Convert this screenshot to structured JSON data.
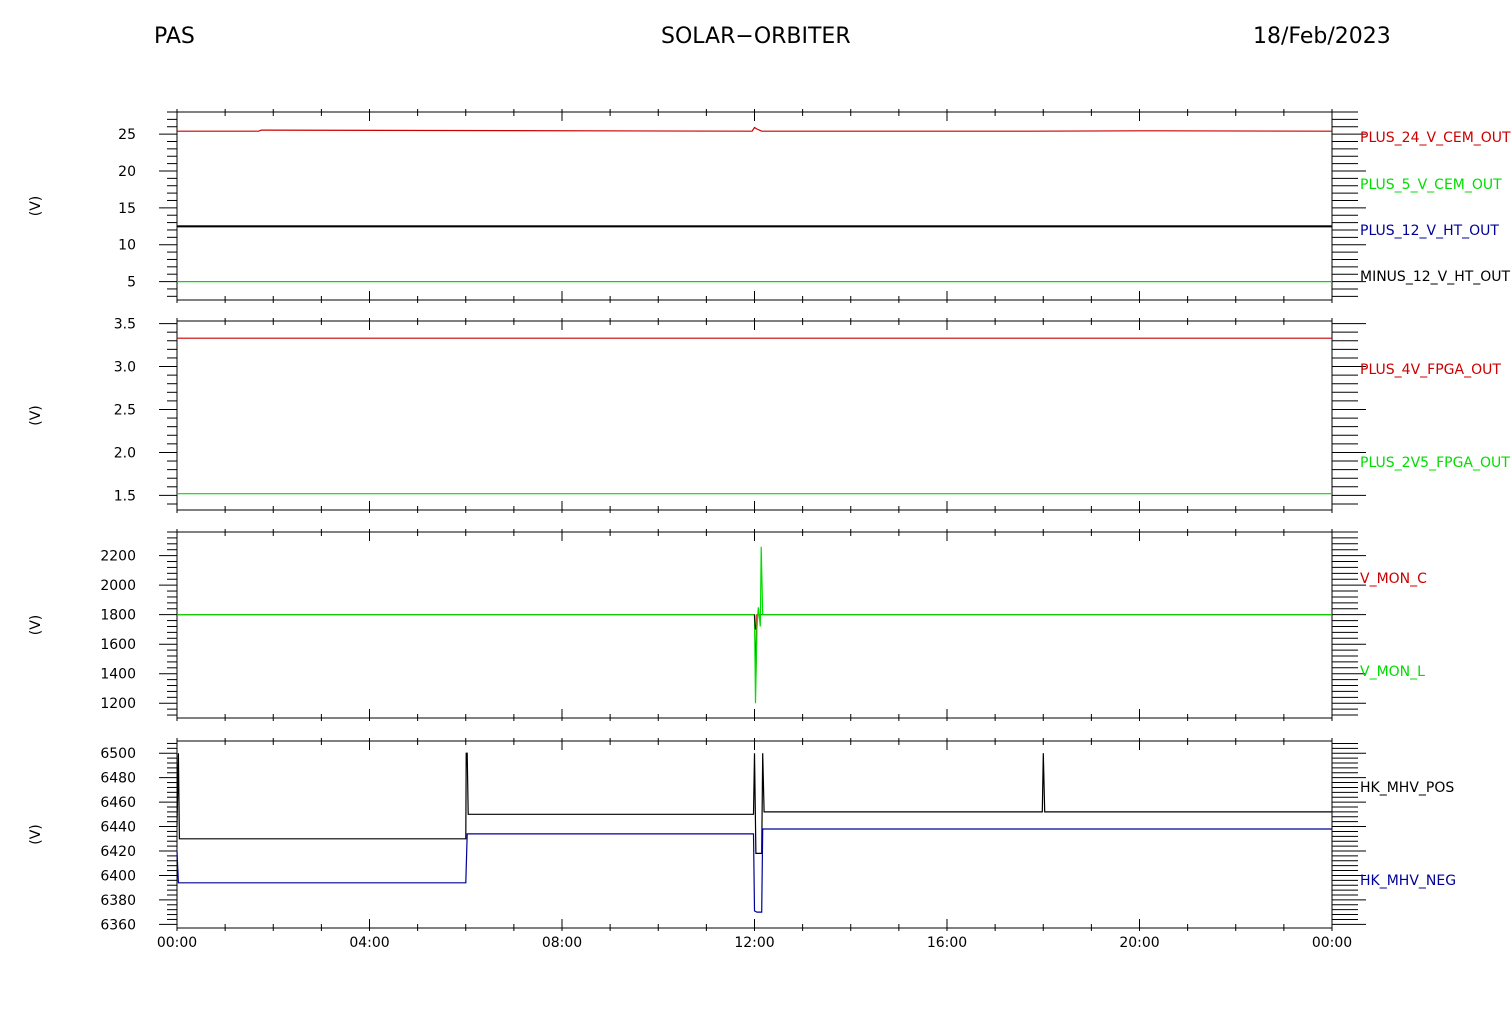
{
  "header": {
    "left": "PAS",
    "center": "SOLAR−ORBITER",
    "right": "18/Feb/2023"
  },
  "chart_data": [
    {
      "type": "line",
      "ylabel": "(V)",
      "ylim": [
        2.5,
        28
      ],
      "yticks": [
        5,
        10,
        15,
        20,
        25
      ],
      "ytick_labels": [
        "5",
        "10",
        "15",
        "20",
        "25"
      ],
      "series": [
        {
          "name": "PLUS_24_V_CEM_OUT",
          "color": "#cc0000",
          "x": [
            0,
            1.7,
            1.75,
            11.95,
            12.0,
            12.05,
            12.15,
            17.7,
            20.3,
            24
          ],
          "y": [
            25.4,
            25.4,
            25.55,
            25.4,
            25.9,
            25.7,
            25.4,
            25.4,
            25.45,
            25.4
          ]
        },
        {
          "name": "PLUS_5_V_CEM_OUT",
          "color": "#00dd00",
          "x": [
            0,
            24
          ],
          "y": [
            5.0,
            5.0
          ]
        },
        {
          "name": "PLUS_12_V_HT_OUT",
          "color": "#000099",
          "x": [
            0,
            24
          ],
          "y": [
            12.5,
            12.5
          ]
        },
        {
          "name": "MINUS_12_V_HT_OUT",
          "color": "#000000",
          "x": [
            0,
            24
          ],
          "y": [
            12.45,
            12.45
          ]
        }
      ]
    },
    {
      "type": "line",
      "ylabel": "(V)",
      "ylim": [
        1.33,
        3.53
      ],
      "yticks": [
        1.5,
        2.0,
        2.5,
        3.0,
        3.5
      ],
      "ytick_labels": [
        "1.5",
        "2.0",
        "2.5",
        "3.0",
        "3.5"
      ],
      "series": [
        {
          "name": "PLUS_4V_FPGA_OUT",
          "color": "#cc0000",
          "x": [
            0,
            24
          ],
          "y": [
            3.33,
            3.33
          ]
        },
        {
          "name": "PLUS_2V5_FPGA_OUT",
          "color": "#00dd00",
          "x": [
            0,
            24
          ],
          "y": [
            1.52,
            1.52
          ]
        }
      ]
    },
    {
      "type": "line",
      "ylabel": "(V)",
      "ylim": [
        1100,
        2360
      ],
      "yticks": [
        1200,
        1400,
        1600,
        1800,
        2000,
        2200
      ],
      "ytick_labels": [
        "1200",
        "1400",
        "1600",
        "1800",
        "2000",
        "2200"
      ],
      "series": [
        {
          "name": "V_MON_C",
          "color": "#cc0000",
          "x": [
            0,
            11.98,
            12.0,
            12.03,
            12.05,
            24
          ],
          "y": [
            1800,
            1800,
            1800,
            1380,
            1800,
            1800
          ]
        },
        {
          "name": "V_MON_L",
          "color": "#00dd00",
          "x": [
            0,
            11.98,
            12.0,
            12.02,
            12.05,
            12.08,
            12.12,
            12.14,
            12.17,
            12.2,
            24
          ],
          "y": [
            1800,
            1800,
            1800,
            1200,
            1700,
            1850,
            1720,
            2260,
            1800,
            1800,
            1800
          ]
        },
        {
          "name": "",
          "color": "#000000",
          "x": [
            12.0,
            12.02
          ],
          "y": [
            1800,
            1700
          ]
        }
      ]
    },
    {
      "type": "line",
      "ylabel": "(V)",
      "ylim": [
        6357,
        6510
      ],
      "yticks": [
        6360,
        6380,
        6400,
        6420,
        6440,
        6460,
        6480,
        6500
      ],
      "ytick_labels": [
        "6360",
        "6380",
        "6400",
        "6420",
        "6440",
        "6460",
        "6480",
        "6500"
      ],
      "series": [
        {
          "name": "HK_MHV_POS",
          "color": "#000000",
          "x": [
            0,
            0.03,
            0.05,
            0.08,
            6.0,
            6.01,
            6.03,
            6.05,
            11.98,
            12.0,
            12.03,
            12.05,
            12.15,
            12.17,
            12.2,
            17.98,
            18.0,
            18.03,
            18.05,
            24
          ],
          "y": [
            6440,
            6500,
            6430,
            6430,
            6430,
            6500,
            6500,
            6450,
            6450,
            6500,
            6418,
            6418,
            6418,
            6500,
            6452,
            6452,
            6500,
            6452,
            6452,
            6452
          ]
        },
        {
          "name": "HK_MHV_NEG",
          "color": "#000099",
          "x": [
            0,
            0.03,
            0.05,
            0.08,
            6.0,
            6.03,
            6.05,
            11.98,
            12.0,
            12.05,
            12.15,
            12.17,
            12.2,
            17.98,
            18.0,
            18.03,
            24
          ],
          "y": [
            6420,
            6394,
            6394,
            6394,
            6394,
            6434,
            6434,
            6434,
            6371,
            6370,
            6370,
            6438,
            6438,
            6438,
            6438,
            6438,
            6438
          ]
        }
      ]
    }
  ],
  "x_axis": {
    "xlim": [
      0,
      24
    ],
    "ticks": [
      0,
      4,
      8,
      12,
      16,
      20,
      24
    ],
    "tick_labels": [
      "00:00",
      "04:00",
      "08:00",
      "12:00",
      "16:00",
      "20:00",
      "00:00"
    ]
  },
  "colors": {
    "red": "#cc0000",
    "green": "#00dd00",
    "blue": "#000099",
    "black": "#000000"
  }
}
